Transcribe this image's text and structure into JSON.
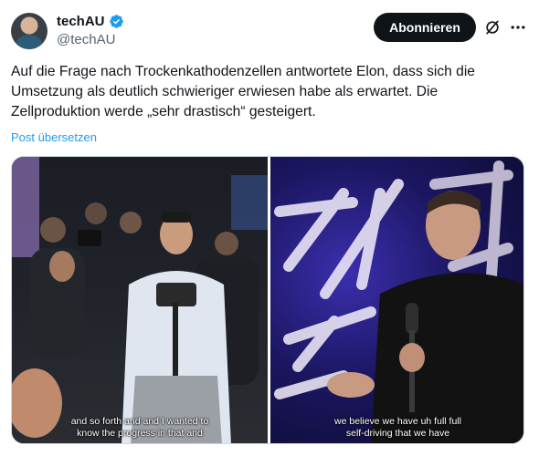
{
  "author": {
    "display_name": "techAU",
    "handle": "@techAU"
  },
  "actions": {
    "subscribe_label": "Abonnieren"
  },
  "post": {
    "text": "Auf die Frage nach Trockenkathodenzellen antwortete Elon, dass sich die Umsetzung als deutlich schwieriger erwiesen habe als erwartet. Die Zellproduktion werde „sehr drastisch“ gesteigert.",
    "translate_label": "Post übersetzen"
  },
  "media": {
    "left_caption_line1": "and so forth and and I wanted to",
    "left_caption_line2": "know the progress in that and",
    "right_caption_line1": "we believe we have uh full full",
    "right_caption_line2": "self-driving that we have"
  },
  "colors": {
    "link": "#1d9bf0",
    "verified": "#1d9bf0",
    "button_bg": "#0f1419",
    "muted_text": "#536471"
  },
  "icons": [
    "verified-badge-icon",
    "grok-icon",
    "more-options-icon"
  ]
}
